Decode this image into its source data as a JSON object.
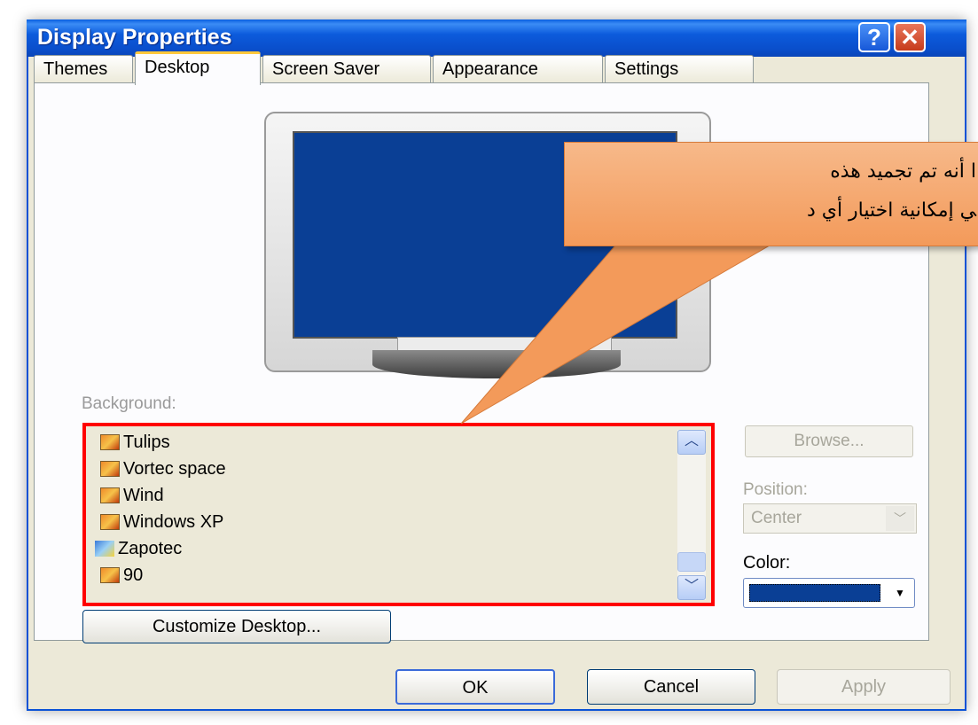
{
  "window": {
    "title": "Display Properties",
    "help_label": "?",
    "close_label": "✕"
  },
  "tabs": [
    {
      "label": "Themes"
    },
    {
      "label": "Desktop"
    },
    {
      "label": "Screen Saver"
    },
    {
      "label": "Appearance"
    },
    {
      "label": "Settings"
    }
  ],
  "background": {
    "label": "Background:",
    "items": [
      {
        "label": "Tulips",
        "icon": "image-file-icon"
      },
      {
        "label": "Vortec space",
        "icon": "image-file-icon"
      },
      {
        "label": "Wind",
        "icon": "image-file-icon"
      },
      {
        "label": "Windows XP",
        "icon": "image-file-icon"
      },
      {
        "label": "Zapotec",
        "icon": "paint-file-icon"
      },
      {
        "label": "90",
        "icon": "image-file-icon"
      }
    ],
    "highlight_color": "#ff0000"
  },
  "controls": {
    "browse_label": "Browse...",
    "position_label": "Position:",
    "position_value": "Center",
    "color_label": "Color:",
    "color_value": "#0a3f95",
    "customize_label": "Customize Desktop..."
  },
  "footer": {
    "ok_label": "OK",
    "cancel_label": "Cancel",
    "apply_label": "Apply"
  },
  "callout": {
    "line1": "ﺍ ﺃﻧﻪ ﺗﻢ ﺗﺠﻤﻴﺪ ﻫﺬﻩ",
    "line2": "ﻲ ﺇﻣﻜﺎﻧﻴﺔ ﺍﺧﺘﻴﺎﺭ ﺃﻱ ﺩ",
    "color": "#f39a5a"
  }
}
